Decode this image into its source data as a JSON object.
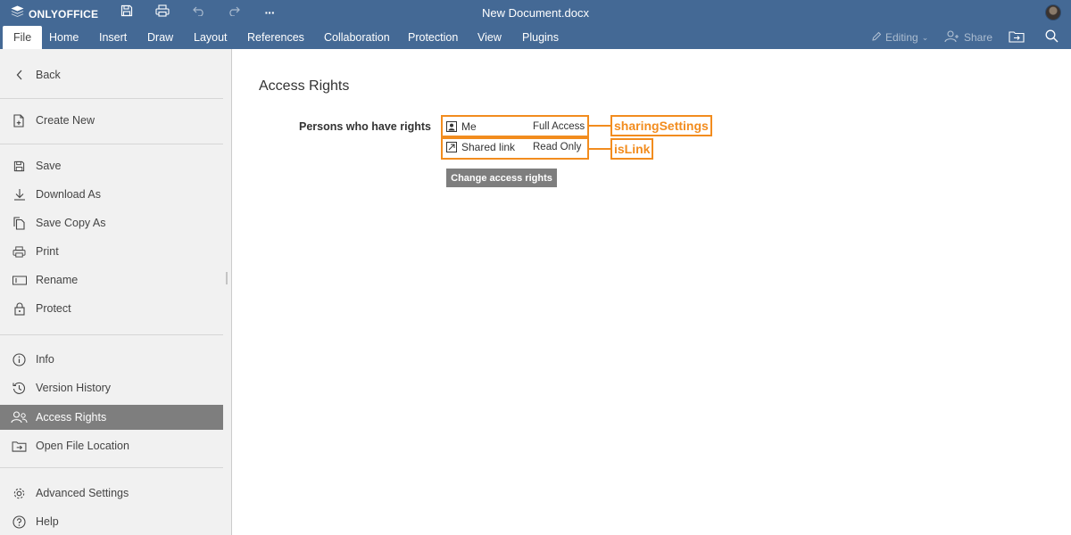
{
  "app": {
    "brand": "ONLYOFFICE",
    "document_title": "New Document.docx",
    "accent_color": "#446995",
    "highlight_color": "#f28c1e"
  },
  "toolbar": {
    "icons": [
      "save-icon",
      "print-icon",
      "undo-icon",
      "redo-icon",
      "more-icon"
    ],
    "more_label": "···"
  },
  "tabs": [
    {
      "label": "File",
      "active": true
    },
    {
      "label": "Home"
    },
    {
      "label": "Insert"
    },
    {
      "label": "Draw"
    },
    {
      "label": "Layout"
    },
    {
      "label": "References"
    },
    {
      "label": "Collaboration"
    },
    {
      "label": "Protection"
    },
    {
      "label": "View"
    },
    {
      "label": "Plugins"
    }
  ],
  "right_tools": {
    "editing_label": "Editing",
    "share_label": "Share"
  },
  "file_menu": {
    "back": "Back",
    "create_new": "Create New",
    "save": "Save",
    "download_as": "Download As",
    "save_copy_as": "Save Copy As",
    "print": "Print",
    "rename": "Rename",
    "protect": "Protect",
    "info": "Info",
    "version_history": "Version History",
    "access_rights": "Access Rights",
    "open_file_location": "Open File Location",
    "advanced_settings": "Advanced Settings",
    "help": "Help"
  },
  "access_rights": {
    "title": "Access Rights",
    "persons_label": "Persons who have rights",
    "rows": [
      {
        "name": "Me",
        "permission": "Full Access",
        "annotation": "sharingSettings"
      },
      {
        "name": "Shared link",
        "permission": "Read Only",
        "annotation": "isLink"
      }
    ],
    "change_button": "Change access rights"
  }
}
